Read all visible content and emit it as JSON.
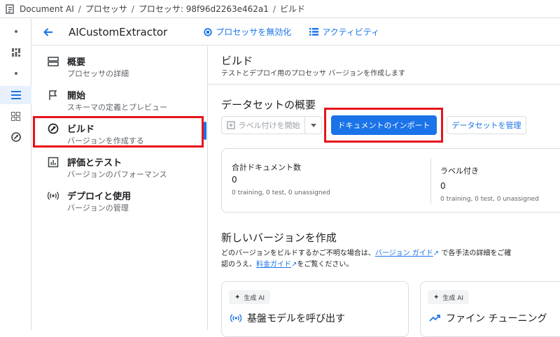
{
  "breadcrumb": {
    "items": [
      "Document AI",
      "プロセッサ",
      "プロセッサ: 98f96d2263e462a1",
      "ビルド"
    ]
  },
  "header": {
    "processor_name": "AICustomExtractor",
    "disable_label": "プロセッサを無効化",
    "activity_label": "アクティビティ"
  },
  "nav": {
    "items": [
      {
        "title": "概要",
        "sub": "プロセッサの詳細",
        "icon": "overview-icon"
      },
      {
        "title": "開始",
        "sub": "スキーマの定義とプレビュー",
        "icon": "flag-icon"
      },
      {
        "title": "ビルド",
        "sub": "バージョンを作成する",
        "icon": "build-icon"
      },
      {
        "title": "評価とテスト",
        "sub": "バージョンのパフォーマンス",
        "icon": "chart-icon"
      },
      {
        "title": "デプロイと使用",
        "sub": "バージョンの管理",
        "icon": "deploy-icon"
      }
    ]
  },
  "main": {
    "title": "ビルド",
    "subtitle": "テストとデプロイ用のプロセッサ バージョンを作成します",
    "dataset": {
      "title": "データセットの概要",
      "label_start": "ラベル付けを開始",
      "import_label": "ドキュメントのインポート",
      "manage_label": "データセットを管理",
      "total_label": "合計ドキュメント数",
      "total_value": "0",
      "total_note": "0 training, 0 test, 0 unassigned",
      "labeled_label": "ラベル付き",
      "labeled_value": "0",
      "labeled_note": "0 training, 0 test, 0 unassigned"
    },
    "create": {
      "title": "新しいバージョンを作成",
      "desc_1": "どのバージョンをビルドするかご不明な場合は、",
      "link_1": "バージョン ガイド",
      "desc_2": " で各手法の詳細をご確",
      "desc_3": "認のうえ、",
      "link_2": "料金ガイド",
      "desc_4": "をご覧ください。"
    },
    "cards": [
      {
        "chip": "生成 AI",
        "title": "基盤モデルを呼び出す"
      },
      {
        "chip": "生成 AI",
        "title": "ファイン チューニング"
      }
    ]
  },
  "colors": {
    "accent": "#1a73e8",
    "highlight": "#e8131b"
  }
}
